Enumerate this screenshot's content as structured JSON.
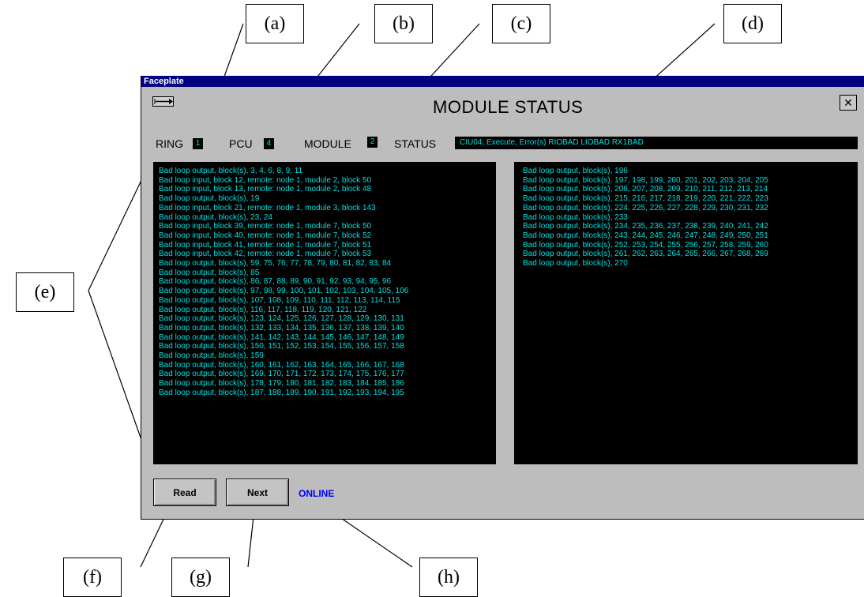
{
  "window": {
    "title": "Faceplate",
    "heading": "MODULE STATUS",
    "close_glyph": "✕"
  },
  "fields": {
    "ring_label": "RING",
    "ring_value": "1",
    "pcu_label": "PCU",
    "pcu_value": "4",
    "module_label": "MODULE",
    "module_value": "2",
    "status_label": "STATUS",
    "status_value": "CIU04, Execute, Error(s) RIOBAD LIOBAD RX1BAD"
  },
  "left_panel": {
    "lines": [
      "Bad loop output, block(s), 3, 4, 6, 8, 9, 11",
      "Bad loop input, block 12, remote: node 1, module 2, block 50",
      "Bad loop input, block 13, remote: node 1, module 2, block 48",
      "Bad loop output, block(s), 19",
      "Bad loop input, block 21, remote: node 1, module 3, block 143",
      "Bad loop output, block(s), 23, 24",
      "Bad loop input, block 39, remote: node 1, module 7, block 50",
      "Bad loop input, block 40, remote: node 1, module 7, block 52",
      "Bad loop input, block 41, remote: node 1, module 7, block 51",
      "Bad loop input, block 42, remote: node 1, module 7, block 53",
      "Bad loop output, block(s), 59, 75, 76, 77, 78, 79, 80, 81, 82, 83, 84",
      "Bad loop output, block(s), 85",
      "Bad loop output, block(s), 86, 87, 88, 89, 90, 91, 92, 93, 94, 95, 96",
      "Bad loop output, block(s), 97, 98, 99, 100, 101, 102, 103, 104, 105, 106",
      "Bad loop output, block(s), 107, 108, 109, 110, 111, 112, 113, 114, 115",
      "Bad loop output, block(s), 116, 117, 118, 119, 120, 121, 122",
      "Bad loop output, block(s), 123, 124, 125, 126, 127, 128, 129, 130, 131",
      "Bad loop output, block(s), 132, 133, 134, 135, 136, 137, 138, 139, 140",
      "Bad loop output, block(s), 141, 142, 143, 144, 145, 146, 147, 148, 149",
      "Bad loop output, block(s), 150, 151, 152, 153, 154, 155, 156, 157, 158",
      "Bad loop output, block(s), 159",
      "Bad loop output, block(s), 160, 161, 162, 163, 164, 165, 166, 167, 168",
      "Bad loop output, block(s), 169, 170, 171, 172, 173, 174, 175, 176, 177",
      "Bad loop output, block(s), 178, 179, 180, 181, 182, 183, 184, 185, 186",
      "Bad loop output, block(s), 187, 188, 189, 190, 191, 192, 193, 194, 195"
    ]
  },
  "right_panel": {
    "lines": [
      "Bad loop output, block(s), 196",
      "Bad loop output, block(s), 197, 198, 199, 200, 201, 202, 203, 204, 205",
      "Bad loop output, block(s), 206, 207, 208, 209, 210, 211, 212, 213, 214",
      "Bad loop output, block(s), 215, 216, 217, 218, 219, 220, 221, 222, 223",
      "Bad loop output, block(s), 224, 225, 226, 227, 228, 229, 230, 231, 232",
      "Bad loop output, block(s), 233",
      "Bad loop output, block(s), 234, 235, 236, 237, 238, 239, 240, 241, 242",
      "Bad loop output, block(s), 243, 244, 245, 246, 247, 248, 249, 250, 251",
      "Bad loop output, block(s), 252, 253, 254, 255, 256, 257, 258, 259, 260",
      "Bad loop output, block(s), 261, 262, 263, 264, 265, 266, 267, 268, 269",
      "Bad loop output, block(s), 270"
    ]
  },
  "buttons": {
    "read": "Read",
    "next": "Next"
  },
  "connection_status": "ONLINE",
  "callouts": {
    "a": "(a)",
    "b": "(b)",
    "c": "(c)",
    "d": "(d)",
    "e": "(e)",
    "f": "(f)",
    "g": "(g)",
    "h": "(h)"
  },
  "colors": {
    "titlebar": "#000080",
    "window_bg": "#bdbdbd",
    "panel_bg": "#000000",
    "panel_text": "#00e0e0",
    "online_text": "#0000ff"
  },
  "icons": {
    "arrow_button": "arrow-right-icon",
    "close_button": "close-icon"
  }
}
